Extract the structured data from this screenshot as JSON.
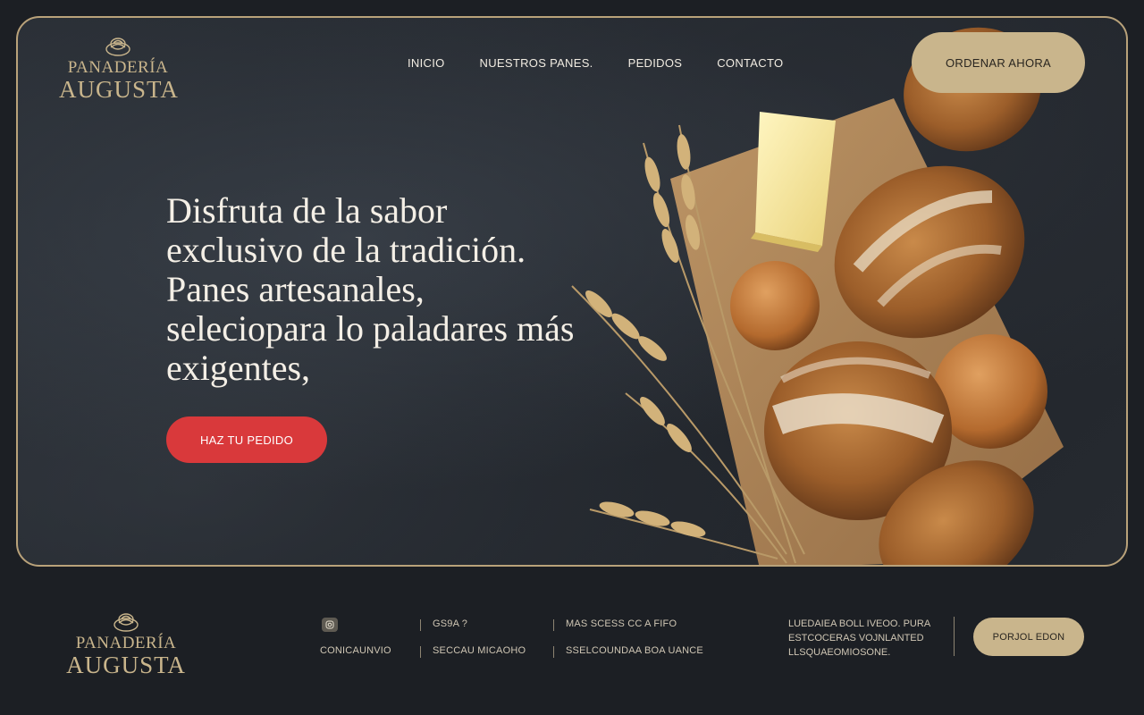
{
  "brand": {
    "line1": "PANADERÍA",
    "line2": "AUGUSTA"
  },
  "nav": {
    "items": [
      "INICIO",
      "NUESTROS PANES.",
      "PEDIDOS",
      "CONTACTO"
    ],
    "order_label": "ORDENAR AHORA"
  },
  "hero": {
    "headline": "Disfruta de la sabor exclusivo de la tradición. Panes artesanales, seleciopara lo paladares más exigentes,",
    "cta_label": "HAZ TU PEDIDO"
  },
  "footer": {
    "brand": {
      "line1": "PANADERÍA",
      "line2": "AUGUSTA"
    },
    "row1": [
      "GS9A ?",
      "MAS SCESS CC A FIFO"
    ],
    "row2": [
      "CONICAUNVIO",
      "SECCAU MICAOHO",
      "SSELCOUNDAA BOA UANCE"
    ],
    "description": "LUEDAIEA BOLL IVEOO. PURA ESTCOCERAS VOJNLANTED LLSQUAEOMIOSONE.",
    "button_label": "PORJOL EDON"
  },
  "colors": {
    "accent_gold": "#c9b58c",
    "cta_red": "#d9393b",
    "background": "#1c1f24"
  },
  "icons": [
    "bread-logo-icon",
    "instagram-icon"
  ]
}
